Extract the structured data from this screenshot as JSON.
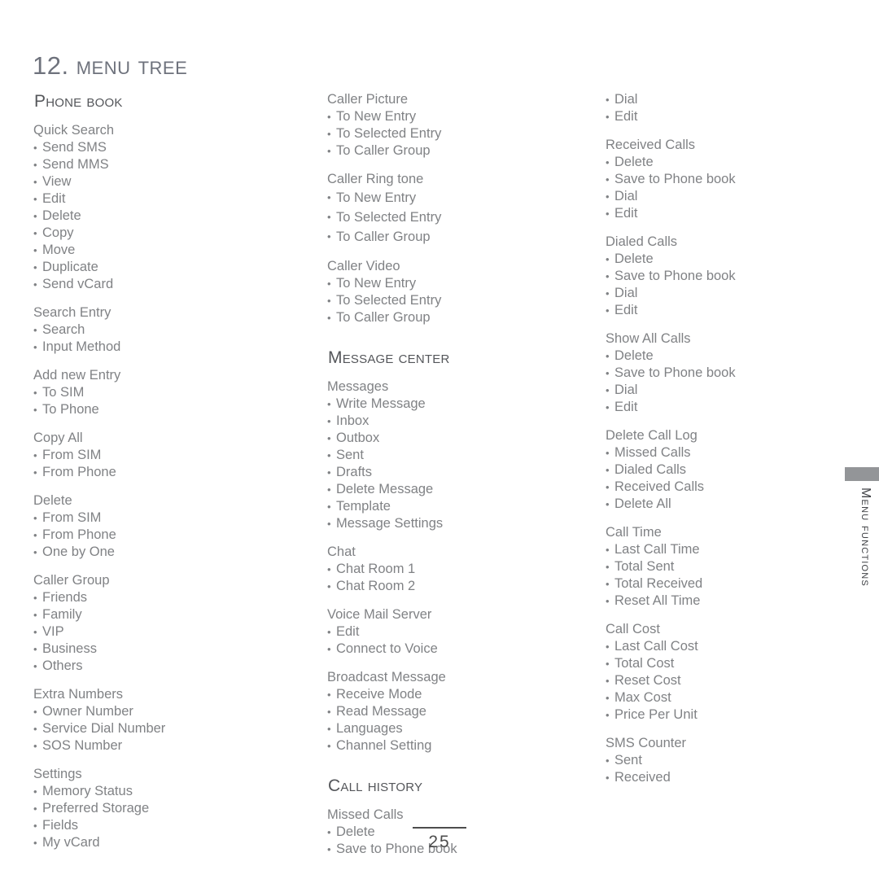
{
  "page": {
    "chapter_title": "12. Menu Tree",
    "page_number": "25",
    "side_tab_label": "Menu Functions",
    "accent_color": "#939598",
    "heading_color": "#54565a",
    "body_color": "#808285",
    "title_color": "#6e727c"
  },
  "columns": [
    {
      "id": "column-1",
      "blocks": [
        {
          "kind": "section",
          "heading": "Phone Book"
        },
        {
          "kind": "group",
          "title": "Quick Search",
          "items": [
            "Send SMS",
            "Send MMS",
            "View",
            "Edit",
            "Delete",
            "Copy",
            "Move",
            "Duplicate",
            "Send vCard"
          ]
        },
        {
          "kind": "group",
          "title": "Search Entry",
          "items": [
            "Search",
            "Input Method"
          ]
        },
        {
          "kind": "group",
          "title": "Add new Entry",
          "items": [
            "To SIM",
            "To Phone"
          ]
        },
        {
          "kind": "group",
          "title": "Copy All",
          "items": [
            "From SIM",
            "From Phone"
          ]
        },
        {
          "kind": "group",
          "title": "Delete",
          "items": [
            "From SIM",
            "From Phone",
            "One by One"
          ]
        },
        {
          "kind": "group",
          "title": "Caller Group",
          "items": [
            "Friends",
            "Family",
            "VIP",
            "Business",
            "Others"
          ]
        },
        {
          "kind": "group",
          "title": "Extra Numbers",
          "items": [
            "Owner Number",
            "Service Dial Number",
            "SOS Number"
          ]
        },
        {
          "kind": "group",
          "title": "Settings",
          "items": [
            "Memory Status",
            "Preferred Storage",
            "Fields",
            "My vCard"
          ]
        }
      ]
    },
    {
      "id": "column-2",
      "blocks": [
        {
          "kind": "group",
          "title": "Caller Picture",
          "items": [
            "To New Entry",
            "To Selected Entry",
            "To Caller Group"
          ]
        },
        {
          "kind": "group",
          "title": "Caller Ring tone",
          "loose": true,
          "items": [
            "To New Entry",
            "To Selected Entry",
            "To Caller Group"
          ]
        },
        {
          "kind": "group",
          "title": "Caller Video",
          "items": [
            "To New Entry",
            "To Selected Entry",
            "To Caller Group"
          ]
        },
        {
          "kind": "section",
          "heading": "Message Center"
        },
        {
          "kind": "group",
          "title": "Messages",
          "items": [
            "Write Message",
            "Inbox",
            "Outbox",
            "Sent",
            "Drafts",
            "Delete Message",
            "Template",
            "Message Settings"
          ]
        },
        {
          "kind": "group",
          "title": "Chat",
          "items": [
            "Chat Room 1",
            "Chat Room 2"
          ]
        },
        {
          "kind": "group",
          "title": "Voice Mail Server",
          "items": [
            "Edit",
            "Connect to Voice"
          ]
        },
        {
          "kind": "group",
          "title": "Broadcast Message",
          "items": [
            "Receive Mode",
            "Read Message",
            "Languages",
            "Channel Setting"
          ]
        },
        {
          "kind": "section",
          "heading": "Call History"
        },
        {
          "kind": "group",
          "title": "Missed Calls",
          "items": [
            "Delete",
            "Save to Phone book"
          ]
        }
      ]
    },
    {
      "id": "column-3",
      "blocks": [
        {
          "kind": "group",
          "title": null,
          "items": [
            "Dial",
            "Edit"
          ]
        },
        {
          "kind": "group",
          "title": "Received Calls",
          "items": [
            "Delete",
            "Save to Phone book",
            "Dial",
            "Edit"
          ]
        },
        {
          "kind": "group",
          "title": "Dialed Calls",
          "items": [
            "Delete",
            "Save to Phone book",
            "Dial",
            "Edit"
          ]
        },
        {
          "kind": "group",
          "title": "Show All Calls",
          "items": [
            "Delete",
            "Save to Phone book",
            "Dial",
            "Edit"
          ]
        },
        {
          "kind": "group",
          "title": "Delete Call Log",
          "items": [
            "Missed Calls",
            "Dialed Calls",
            "Received Calls",
            "Delete All"
          ]
        },
        {
          "kind": "group",
          "title": "Call Time",
          "items": [
            "Last Call Time",
            "Total Sent",
            "Total Received",
            "Reset All Time"
          ]
        },
        {
          "kind": "group",
          "title": "Call Cost",
          "items": [
            "Last Call Cost",
            "Total Cost",
            "Reset Cost",
            "Max Cost",
            "Price Per Unit"
          ]
        },
        {
          "kind": "group",
          "title": "SMS Counter",
          "items": [
            "Sent",
            "Received"
          ]
        }
      ]
    }
  ]
}
